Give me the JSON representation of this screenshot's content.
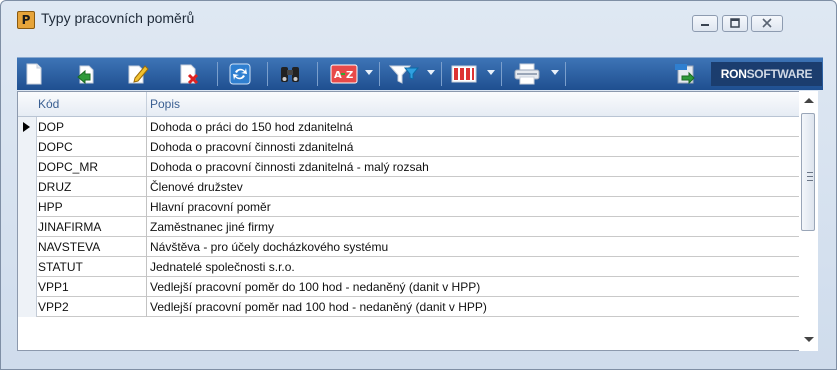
{
  "window": {
    "title": "Typy pracovních poměrů",
    "app_icon_letter": "P"
  },
  "toolbar": {
    "buttons": [
      {
        "name": "new",
        "icon": "new-document-icon"
      },
      {
        "name": "import",
        "icon": "import-arrow-icon"
      },
      {
        "name": "edit",
        "icon": "edit-document-icon"
      },
      {
        "name": "delete",
        "icon": "delete-document-icon"
      },
      {
        "name": "refresh",
        "icon": "refresh-icon"
      },
      {
        "name": "find",
        "icon": "binoculars-icon"
      },
      {
        "name": "sort",
        "icon": "sort-az-icon"
      },
      {
        "name": "filter",
        "icon": "filter-icon"
      },
      {
        "name": "columns",
        "icon": "columns-icon"
      },
      {
        "name": "print",
        "icon": "printer-icon"
      },
      {
        "name": "export",
        "icon": "export-icon"
      }
    ],
    "brand_part1": "RON",
    "brand_part2": "SOFTWARE"
  },
  "grid": {
    "columns": [
      "Kód",
      "Popis"
    ],
    "rows": [
      {
        "kod": "DOP",
        "popis": "Dohoda o práci  do 150 hod  zdanitelná"
      },
      {
        "kod": "DOPC",
        "popis": "Dohoda o pracovní činnosti zdanitelná"
      },
      {
        "kod": "DOPC_MR",
        "popis": "Dohoda o pracovní činnosti zdanitelná - malý rozsah"
      },
      {
        "kod": "DRUZ",
        "popis": "Členové družstev"
      },
      {
        "kod": "HPP",
        "popis": "Hlavní pracovní poměr"
      },
      {
        "kod": "JINAFIRMA",
        "popis": "Zaměstnanec jiné firmy"
      },
      {
        "kod": "NAVSTEVA",
        "popis": "Návštěva - pro účely docházkového systému"
      },
      {
        "kod": "STATUT",
        "popis": "Jednatelé společnosti s.r.o."
      },
      {
        "kod": "VPP1",
        "popis": "Vedlejší pracovní poměr do 100 hod - nedaněný (danit v HPP)"
      },
      {
        "kod": "VPP2",
        "popis": "Vedlejší pracovní poměr nad 100 hod - nedaněný (danit v HPP)"
      }
    ],
    "selected_row": 0
  },
  "colors": {
    "toolbar": "#2b5f9f",
    "header_text": "#3a5f92"
  }
}
